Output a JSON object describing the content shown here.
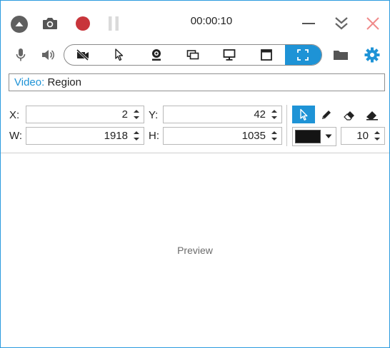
{
  "title_bar": {
    "timer": "00:00:10",
    "icons": [
      "collapse-icon",
      "camera-icon",
      "record-icon",
      "pause-icon",
      "minimize-icon",
      "chevrons-down-icon",
      "close-icon"
    ]
  },
  "toolbar": {
    "mic_icon": "microphone-icon",
    "speaker_icon": "speaker-icon",
    "sources": [
      "no-video-icon",
      "cursor-icon",
      "webcam-icon",
      "screen-icon",
      "window-icon",
      "region-icon"
    ],
    "active_source": "region-icon",
    "folder_icon": "folder-icon",
    "settings_icon": "gear-icon"
  },
  "video_mode": {
    "key": "Video:",
    "value": "Region"
  },
  "coords": {
    "x_label": "X:",
    "x_value": "2",
    "y_label": "Y:",
    "y_value": "42",
    "w_label": "W:",
    "w_value": "1918",
    "h_label": "H:",
    "h_value": "1035"
  },
  "drawing": {
    "tools": [
      "pointer-icon",
      "pencil-icon",
      "eraser-icon",
      "clear-eraser-icon"
    ],
    "active_tool": "pointer-icon",
    "brush_color": "#141414",
    "brush_size": "10"
  },
  "preview": {
    "label": "Preview"
  },
  "colors": {
    "accent": "#1e93d6",
    "record": "#c8353b",
    "close": "#f08a8a"
  }
}
